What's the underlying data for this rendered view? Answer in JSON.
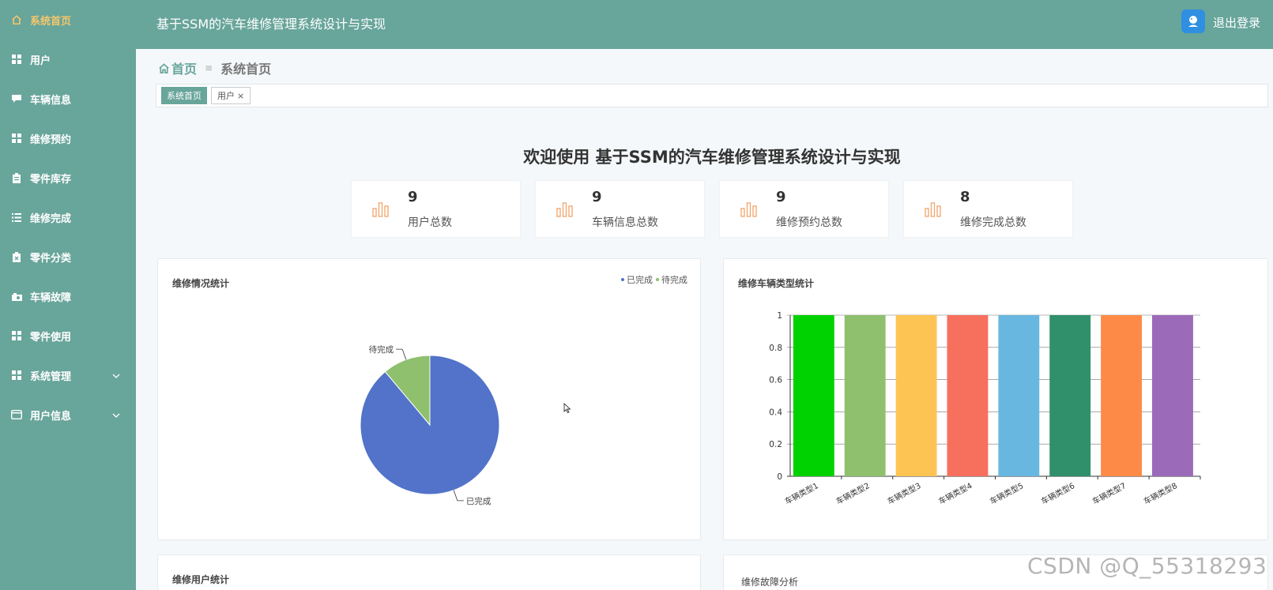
{
  "sidebar": {
    "items": [
      {
        "label": "系统首页",
        "icon": "home-icon",
        "active": true
      },
      {
        "label": "用户",
        "icon": "grid-icon"
      },
      {
        "label": "车辆信息",
        "icon": "chat-icon"
      },
      {
        "label": "维修预约",
        "icon": "grid-icon"
      },
      {
        "label": "零件库存",
        "icon": "clipboard-icon"
      },
      {
        "label": "维修完成",
        "icon": "list-icon"
      },
      {
        "label": "零件分类",
        "icon": "clipboard-x-icon"
      },
      {
        "label": "车辆故障",
        "icon": "camera-icon"
      },
      {
        "label": "零件使用",
        "icon": "grid-icon"
      },
      {
        "label": "系统管理",
        "icon": "grid-icon",
        "chevron": true
      },
      {
        "label": "用户信息",
        "icon": "card-icon",
        "chevron": true
      }
    ]
  },
  "header": {
    "title": "基于SSM的汽车维修管理系统设计与实现",
    "logout": "退出登录"
  },
  "breadcrumb": {
    "home": "首页",
    "separator": "≡",
    "current": "系统首页"
  },
  "tabs": {
    "active": "系统首页",
    "other": "用户",
    "close": "×"
  },
  "welcome": "欢迎使用 基于SSM的汽车维修管理系统设计与实现",
  "stats": [
    {
      "value": "9",
      "label": "用户总数"
    },
    {
      "value": "9",
      "label": "车辆信息总数"
    },
    {
      "value": "9",
      "label": "维修预约总数"
    },
    {
      "value": "8",
      "label": "维修完成总数"
    }
  ],
  "panels": {
    "pie_title": "维修情况统计",
    "bar_title": "维修车辆类型统计",
    "user_title": "维修用户统计",
    "fault_title": "维修故障分析"
  },
  "colors": {
    "accent": "#68a59b",
    "active_menu": "#f5c76b",
    "stat_icon": "#f0a56a"
  },
  "chart_data": [
    {
      "type": "pie",
      "title": "维修情况统计",
      "legend": [
        "已完成",
        "待完成"
      ],
      "legend_position": "top-right",
      "slices": [
        {
          "name": "已完成",
          "value": 8,
          "color": "#5273c9"
        },
        {
          "name": "待完成",
          "value": 1,
          "color": "#8fc06e"
        }
      ]
    },
    {
      "type": "bar",
      "title": "维修车辆类型统计",
      "categories": [
        "车辆类型1",
        "车辆类型2",
        "车辆类型3",
        "车辆类型4",
        "车辆类型5",
        "车辆类型6",
        "车辆类型7",
        "车辆类型8"
      ],
      "values": [
        1,
        1,
        1,
        1,
        1,
        1,
        1,
        1
      ],
      "colors": [
        "#00d100",
        "#8fc06e",
        "#fdc453",
        "#f7705e",
        "#68b7e0",
        "#2f906b",
        "#fd8b47",
        "#9b6ab8"
      ],
      "ylim": [
        0,
        1
      ],
      "yticks": [
        "0",
        "0.2",
        "0.4",
        "0.6",
        "0.8",
        "1"
      ],
      "grid": true
    }
  ],
  "watermark": "CSDN @Q_55318293"
}
